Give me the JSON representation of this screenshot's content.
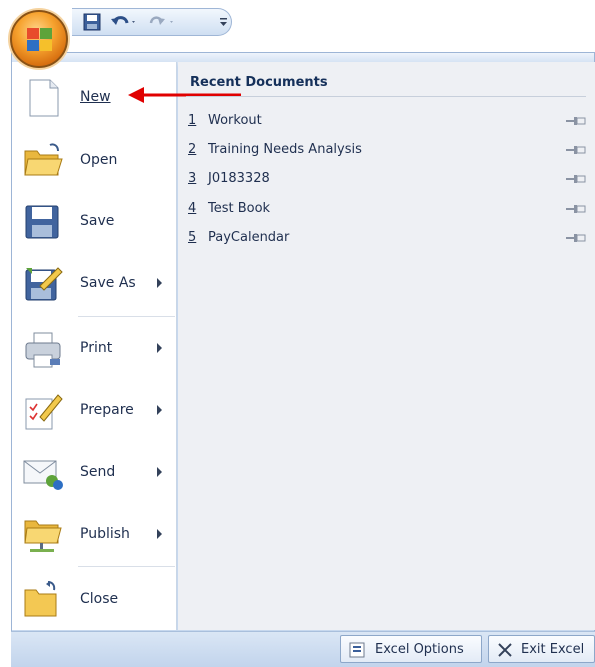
{
  "quick_access": {
    "save_icon": "save-icon",
    "undo_icon": "undo-icon",
    "redo_icon": "redo-icon",
    "customize_icon": "customize-dropdown-icon"
  },
  "office_button": {
    "icon": "office-logo-icon"
  },
  "menu": {
    "items": [
      {
        "label": "New",
        "icon": "new-document-icon",
        "submenu": false
      },
      {
        "label": "Open",
        "icon": "open-folder-icon",
        "submenu": false
      },
      {
        "label": "Save",
        "icon": "save-disk-icon",
        "submenu": false
      },
      {
        "label": "Save As",
        "icon": "save-as-icon",
        "submenu": true
      },
      {
        "label": "Print",
        "icon": "printer-icon",
        "submenu": true
      },
      {
        "label": "Prepare",
        "icon": "prepare-icon",
        "submenu": true
      },
      {
        "label": "Send",
        "icon": "send-icon",
        "submenu": true
      },
      {
        "label": "Publish",
        "icon": "publish-icon",
        "submenu": true
      },
      {
        "label": "Close",
        "icon": "close-folder-icon",
        "submenu": false
      }
    ]
  },
  "recent": {
    "title": "Recent Documents",
    "documents": [
      {
        "num": "1",
        "name": "Workout"
      },
      {
        "num": "2",
        "name": "Training Needs Analysis"
      },
      {
        "num": "3",
        "name": "J0183328"
      },
      {
        "num": "4",
        "name": "Test Book"
      },
      {
        "num": "5",
        "name": "PayCalendar"
      }
    ]
  },
  "bottom": {
    "options_label": "Excel Options",
    "exit_label": "Exit Excel"
  },
  "colors": {
    "annotation_arrow": "#e00000",
    "accent_orange": "#f6a22e",
    "frame_blue": "#c7d8ee"
  }
}
